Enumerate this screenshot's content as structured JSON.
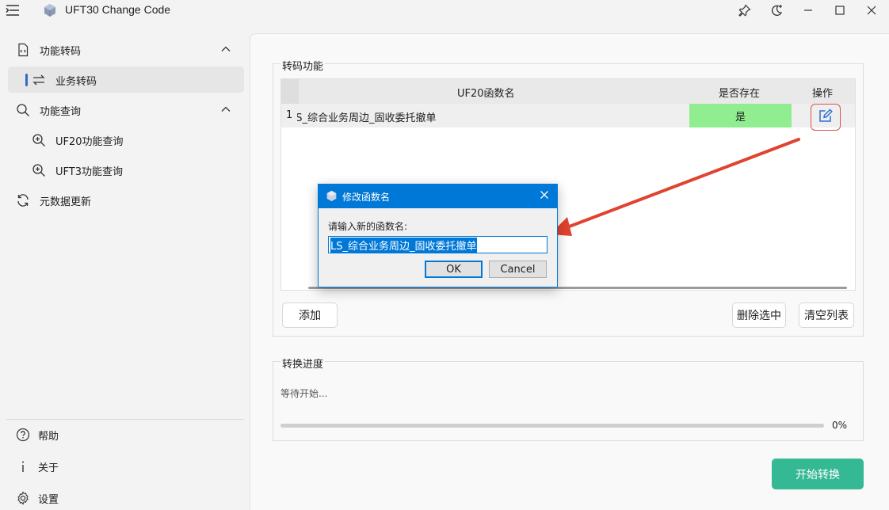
{
  "app": {
    "title": "UFT30 Change Code"
  },
  "titlebar": {
    "icons": [
      "pin-icon",
      "theme-toggle-icon",
      "minimize-icon",
      "maximize-icon",
      "close-icon"
    ]
  },
  "sidebar": {
    "items": [
      {
        "label": "功能转码",
        "icon": "code-file-icon",
        "expanded": true
      },
      {
        "label": "业务转码",
        "icon": "swap-icon",
        "active": true
      },
      {
        "label": "功能查询",
        "icon": "search-icon",
        "expanded": true
      },
      {
        "label": "UF20功能查询",
        "icon": "zoom-in-icon"
      },
      {
        "label": "UFT3功能查询",
        "icon": "zoom-in-icon"
      },
      {
        "label": "元数据更新",
        "icon": "refresh-icon"
      }
    ],
    "footer": [
      {
        "label": "帮助",
        "icon": "help-icon"
      },
      {
        "label": "关于",
        "icon": "info-icon"
      },
      {
        "label": "设置",
        "icon": "settings-icon"
      }
    ]
  },
  "transcode": {
    "section_label": "转码功能",
    "table": {
      "headers": [
        "UF20函数名",
        "是否存在",
        "操作"
      ],
      "rows": [
        {
          "index": "1",
          "name": "LS_综合业务周边_固收委托撤单",
          "exists": "是"
        }
      ]
    },
    "buttons": {
      "add": "添加",
      "delete_selected": "删除选中",
      "clear_list": "清空列表"
    }
  },
  "progress": {
    "section_label": "转换进度",
    "status": "等待开始...",
    "percent_label": "0%",
    "fraction": 0
  },
  "start_button": "开始转换",
  "dialog": {
    "title": "修改函数名",
    "prompt": "请输入新的函数名:",
    "value": "LS_综合业务周边_固收委托撤单",
    "ok": "OK",
    "cancel": "Cancel"
  },
  "colors": {
    "accent": "#35b894",
    "exists_bg": "#90ee90",
    "dialog_title": "#0078d7",
    "annotation": "#e0432f"
  }
}
